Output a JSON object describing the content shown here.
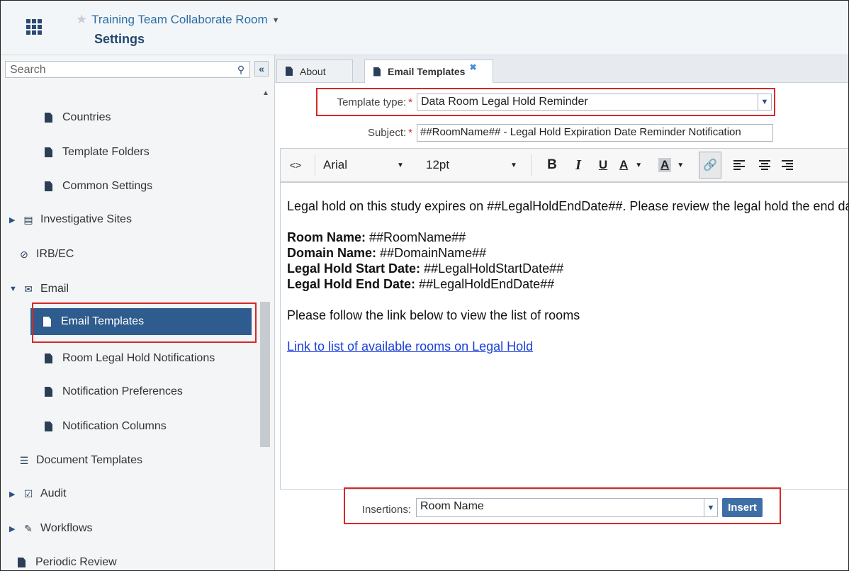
{
  "header": {
    "room_title": "Training Team Collaborate Room",
    "page_title": "Settings"
  },
  "sidebar": {
    "search_placeholder": "Search",
    "items": [
      {
        "label": "Countries"
      },
      {
        "label": "Template Folders"
      },
      {
        "label": "Common Settings"
      },
      {
        "label": "Investigative Sites"
      },
      {
        "label": "IRB/EC"
      },
      {
        "label": "Email"
      },
      {
        "label": "Email Templates",
        "selected": true
      },
      {
        "label": "Room Legal Hold Notifications"
      },
      {
        "label": "Notification Preferences"
      },
      {
        "label": "Notification Columns"
      },
      {
        "label": "Document Templates"
      },
      {
        "label": "Audit"
      },
      {
        "label": "Workflows"
      },
      {
        "label": "Periodic Review"
      }
    ]
  },
  "tabs": [
    {
      "label": "About"
    },
    {
      "label": "Email Templates",
      "active": true
    }
  ],
  "form": {
    "template_type_label": "Template type:",
    "template_type_value": "Data Room Legal Hold Reminder",
    "subject_label": "Subject:",
    "subject_value": "##RoomName## - Legal Hold Expiration Date Reminder Notification",
    "required_mark": "*"
  },
  "toolbar": {
    "source_label": "<>",
    "font_family": "Arial",
    "font_size": "12pt",
    "bold": "B",
    "italic": "I",
    "underline": "U",
    "text_color": "A",
    "bg_color": "A"
  },
  "editor": {
    "intro": "Legal hold on this study expires on ##LegalHoldEndDate##. Please review the legal hold the end date.",
    "room_name_label": "Room Name:",
    "room_name_value": "##RoomName##",
    "domain_name_label": "Domain Name:",
    "domain_name_value": "##DomainName##",
    "start_date_label": "Legal Hold Start Date:",
    "start_date_value": "##LegalHoldStartDate##",
    "end_date_label": "Legal Hold End Date:",
    "end_date_value": "##LegalHoldEndDate##",
    "follow_text": "Please follow the link below to view the list of rooms",
    "link_text": "Link to list of available rooms on Legal Hold"
  },
  "insertions": {
    "label": "Insertions:",
    "value": "Room Name",
    "insert_button": "Insert"
  },
  "colors": {
    "highlight": "#d62828",
    "selected_nav": "#2e5c8f",
    "link": "#1a3fd8"
  }
}
